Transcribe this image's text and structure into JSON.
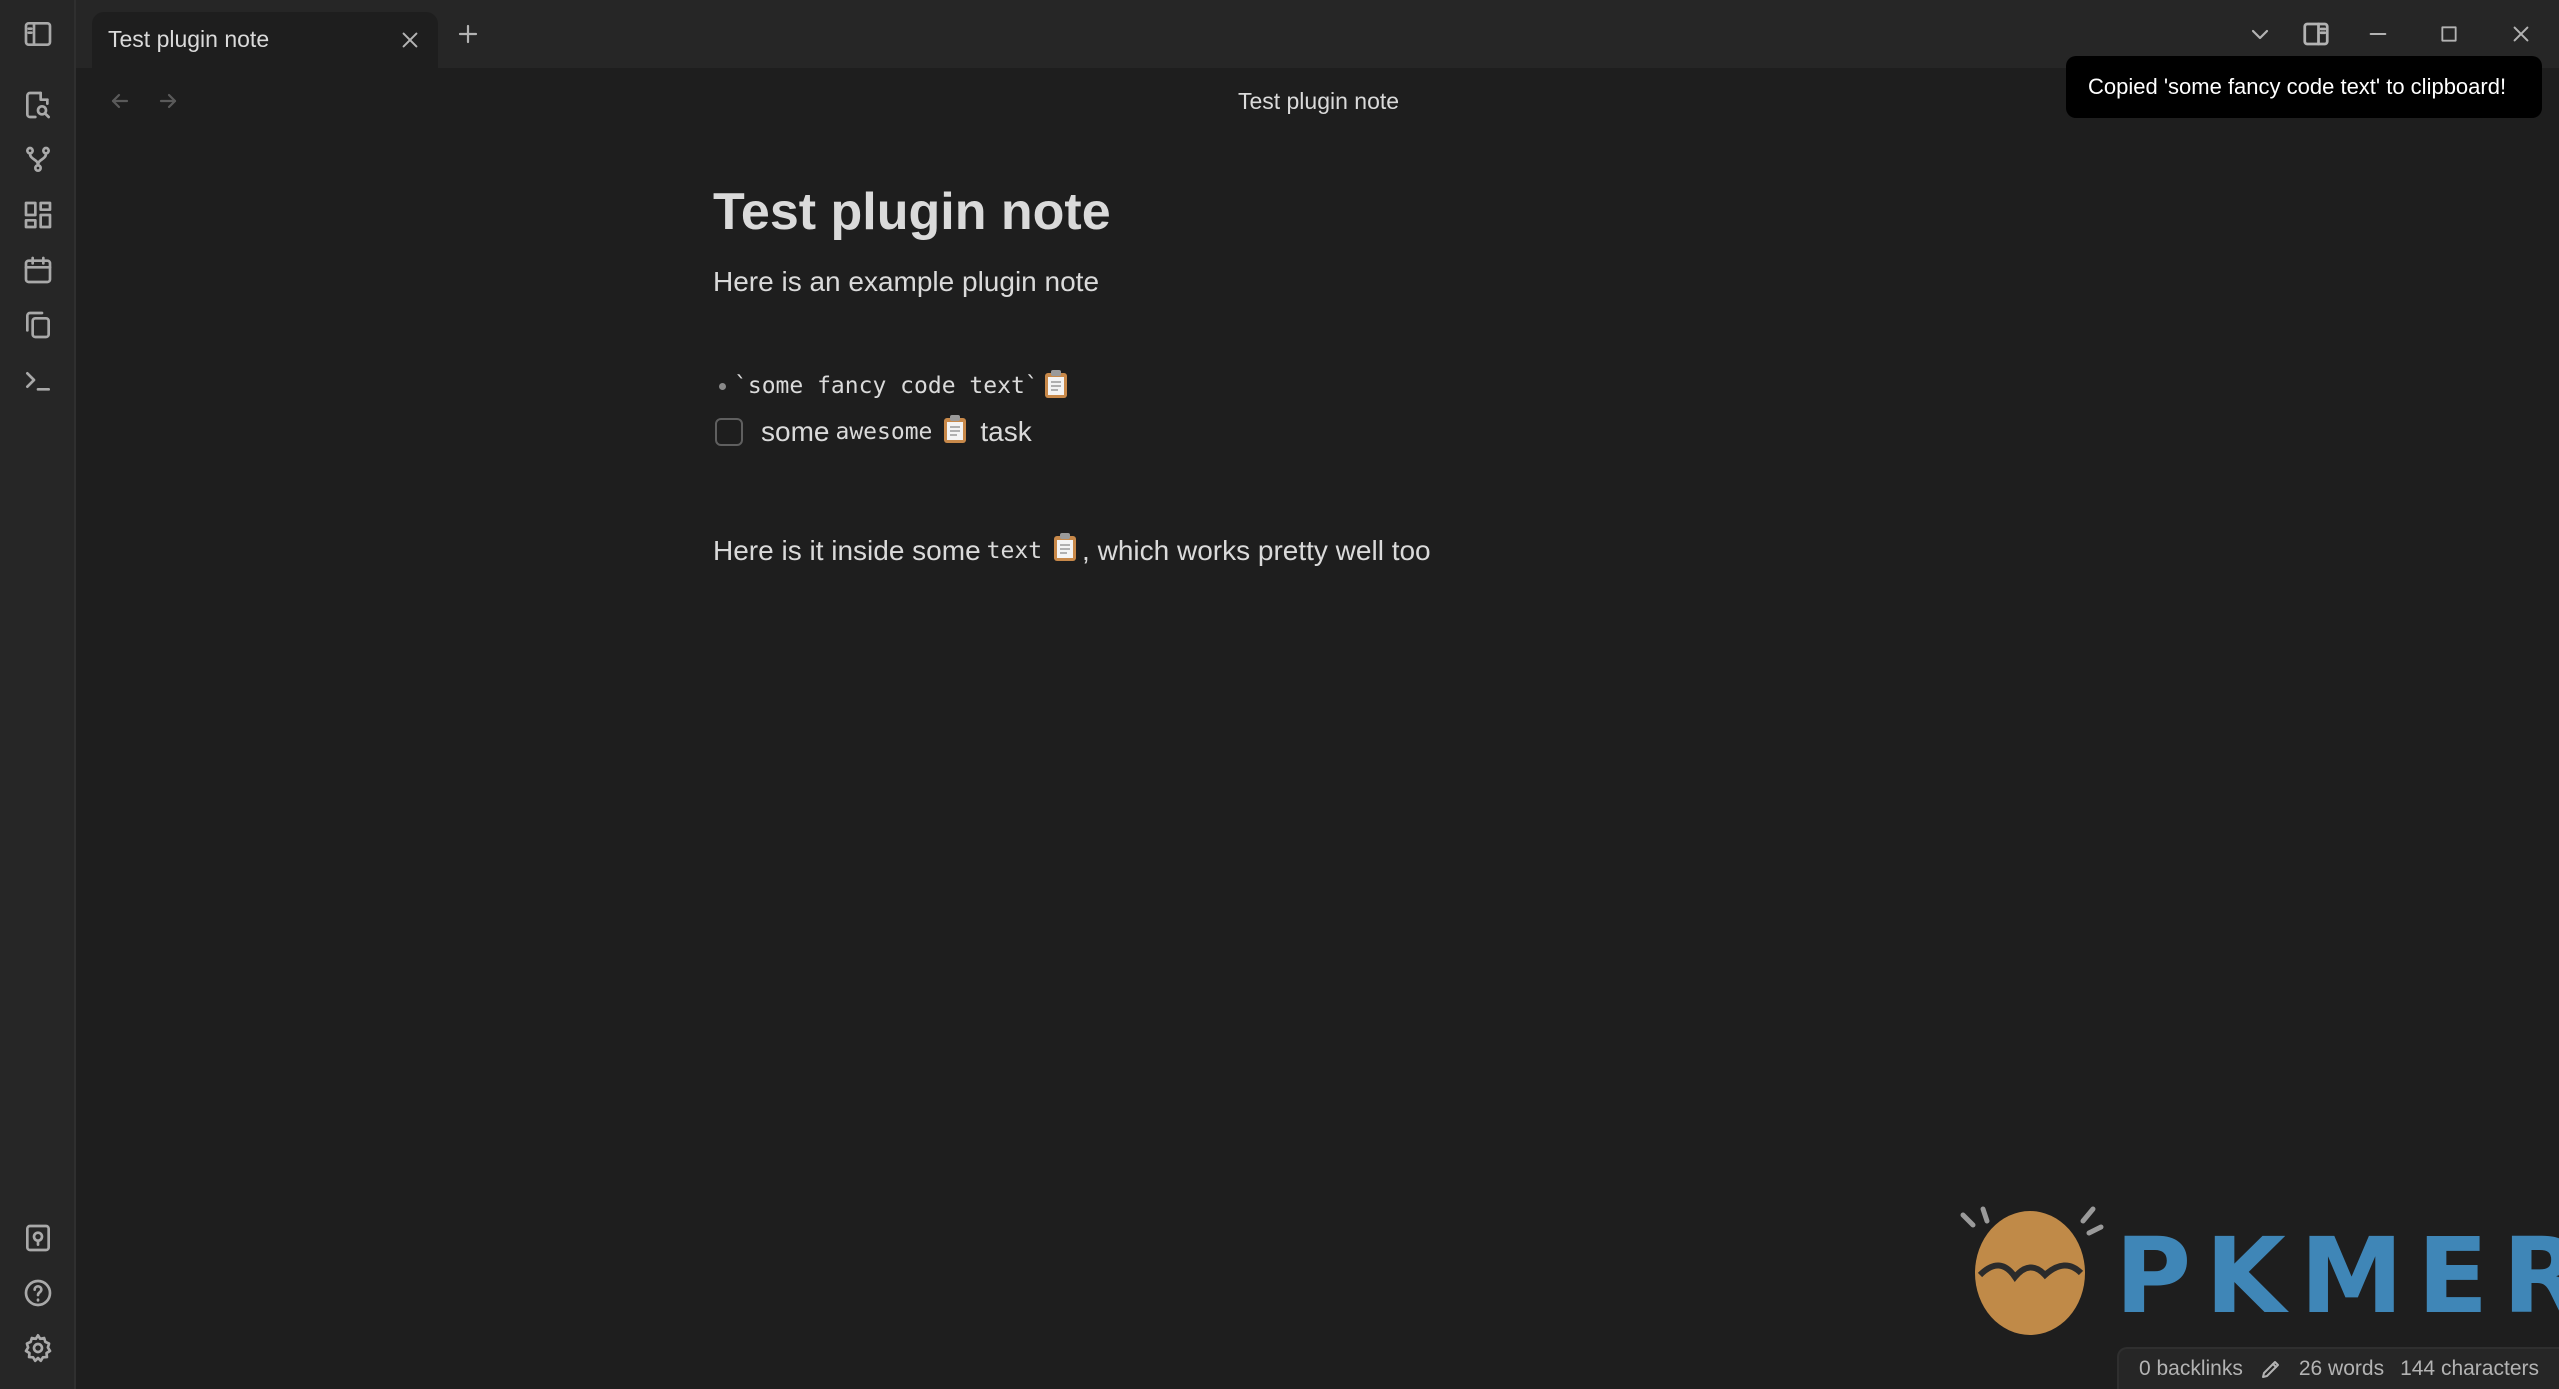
{
  "tabs": [
    {
      "title": "Test plugin note"
    }
  ],
  "view_header": {
    "title": "Test plugin note"
  },
  "notice": {
    "text": "Copied 'some fancy code text' to clipboard!"
  },
  "note": {
    "heading": "Test plugin note",
    "intro": "Here is an example plugin note",
    "bullet": {
      "code": "`some fancy code text`"
    },
    "task": {
      "before": "some",
      "code": "awesome",
      "after": "task",
      "checked": false
    },
    "para2": {
      "before": "Here is it inside some",
      "code": "text",
      "after": ", which works pretty well too"
    }
  },
  "watermark": {
    "text": "PKMER"
  },
  "status": {
    "backlinks": "0 backlinks",
    "words": "26 words",
    "characters": "144 characters"
  },
  "icons": {
    "ribbon": [
      "sidebar-toggle-icon",
      "search-file-icon",
      "graph-icon",
      "canvas-icon",
      "calendar-icon",
      "copy-files-icon",
      "terminal-icon",
      "vault-icon",
      "help-icon",
      "settings-icon"
    ],
    "clipboard": "clipboard-icon"
  },
  "colors": {
    "background": "#1e1e1e",
    "ribbon": "#262626",
    "notice_bg": "#000000",
    "watermark": "#3f86b7"
  }
}
